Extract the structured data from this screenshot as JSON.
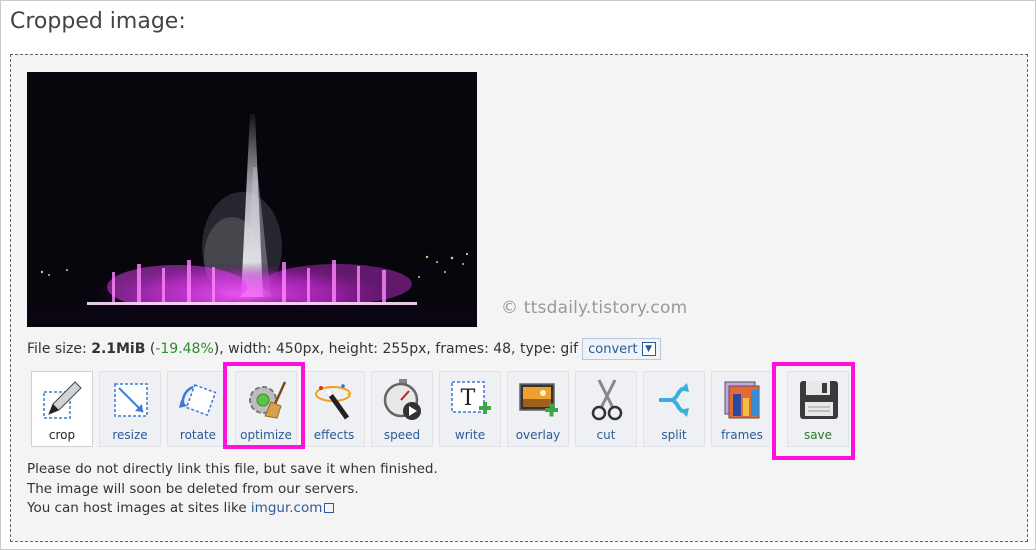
{
  "page": {
    "title": "Cropped image:"
  },
  "preview": {
    "watermark": "© ttsdaily.tistory.com"
  },
  "file_info": {
    "prefix": "File size: ",
    "size": "2.1MiB",
    "open_paren": " (",
    "change": "-19.48%",
    "details": "), width: 450px, height: 255px, frames: 48, type: gif",
    "convert_label": "convert"
  },
  "tools": [
    {
      "key": "crop",
      "label": "crop",
      "icon": "pen-crop-icon"
    },
    {
      "key": "resize",
      "label": "resize",
      "icon": "resize-icon"
    },
    {
      "key": "rotate",
      "label": "rotate",
      "icon": "rotate-icon"
    },
    {
      "key": "optimize",
      "label": "optimize",
      "icon": "gear-broom-icon"
    },
    {
      "key": "effects",
      "label": "effects",
      "icon": "magic-wand-icon"
    },
    {
      "key": "speed",
      "label": "speed",
      "icon": "stopwatch-icon"
    },
    {
      "key": "write",
      "label": "write",
      "icon": "text-add-icon"
    },
    {
      "key": "overlay",
      "label": "overlay",
      "icon": "image-add-icon"
    },
    {
      "key": "cut",
      "label": "cut",
      "icon": "scissors-icon"
    },
    {
      "key": "split",
      "label": "split",
      "icon": "split-arrows-icon"
    },
    {
      "key": "frames",
      "label": "frames",
      "icon": "frames-icon"
    },
    {
      "key": "save",
      "label": "save",
      "icon": "floppy-disk-icon"
    }
  ],
  "notes": {
    "line1": "Please do not directly link this file, but save it when finished.",
    "line2": "The image will soon be deleted from our servers.",
    "line3_prefix": "You can host images at sites like ",
    "line3_link": "imgur.com"
  },
  "colors": {
    "highlight": "#ff11dd",
    "link": "#2a5b95",
    "change": "#2e8b2e"
  }
}
